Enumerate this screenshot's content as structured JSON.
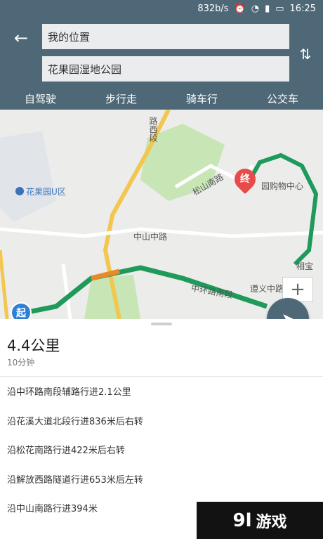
{
  "status_bar": {
    "speed": "832b/s",
    "time": "16:25",
    "icons": [
      "alarm-icon",
      "wifi-icon",
      "signal-icon",
      "battery-icon"
    ]
  },
  "header": {
    "origin": "我的位置",
    "destination": "花果园湿地公园",
    "back_icon": "back-arrow-icon",
    "swap_icon": "swap-icon",
    "modes": [
      {
        "label": "自驾驶"
      },
      {
        "label": "步行走"
      },
      {
        "label": "骑车行"
      },
      {
        "label": "公交车"
      }
    ]
  },
  "map": {
    "labels": {
      "road_west": "路西段",
      "poi_huaguoyuan": "花果园U区",
      "songshan": "松山南路",
      "mall": "园购物中心",
      "zhongshan": "中山中路",
      "zunyi": "遵义中路",
      "xiangshi": "相宝",
      "ring": "中环路南段",
      "start": "起",
      "end": "终"
    },
    "route_color": "#1e9a5a",
    "congestion_color": "#e88a2a"
  },
  "summary": {
    "distance": "4.4公里",
    "duration": "10分钟"
  },
  "steps": [
    "沿中环路南段辅路行进2.1公里",
    "沿花溪大道北段行进836米后右转",
    "沿松花南路行进422米后右转",
    "沿解放西路隧道行进653米后左转",
    "沿中山南路行进394米"
  ],
  "watermark": {
    "badge": "9l",
    "text": "游戏"
  }
}
